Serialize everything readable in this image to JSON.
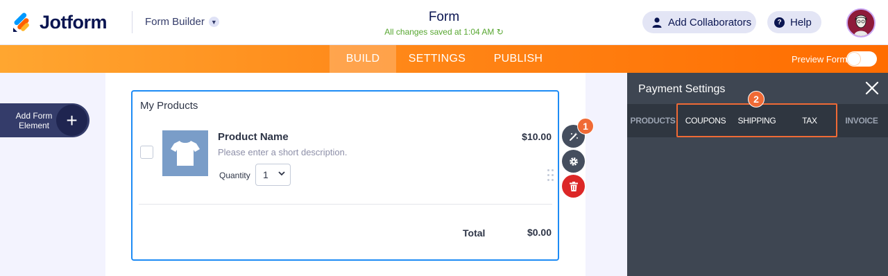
{
  "header": {
    "logo_text": "Jotform",
    "mode_label": "Form Builder",
    "form_title": "Form",
    "save_status": "All changes saved at 1:04 AM",
    "collaborators_label": "Add Collaborators",
    "help_label": "Help"
  },
  "nav": {
    "tabs": [
      {
        "label": "BUILD",
        "active": true
      },
      {
        "label": "SETTINGS",
        "active": false
      },
      {
        "label": "PUBLISH",
        "active": false
      }
    ],
    "preview_label": "Preview Form"
  },
  "sidebar": {
    "add_element_label": "Add Form Element"
  },
  "widget": {
    "title": "My Products",
    "product": {
      "name": "Product Name",
      "description": "Please enter a short description.",
      "quantity_label": "Quantity",
      "quantity_value": "1",
      "price": "$10.00"
    },
    "total_label": "Total",
    "total_value": "$0.00"
  },
  "badges": {
    "one": "1",
    "two": "2"
  },
  "panel": {
    "title": "Payment Settings",
    "tabs": [
      "PRODUCTS",
      "COUPONS",
      "SHIPPING",
      "TAX",
      "INVOICE"
    ]
  },
  "colors": {
    "brand_navy": "#0a1551",
    "nav_orange": "#ff7a00",
    "accent_blue": "#1d8bf5",
    "badge_orange": "#f06a35",
    "delete_red": "#dc2727",
    "panel_bg": "#3e4652"
  }
}
